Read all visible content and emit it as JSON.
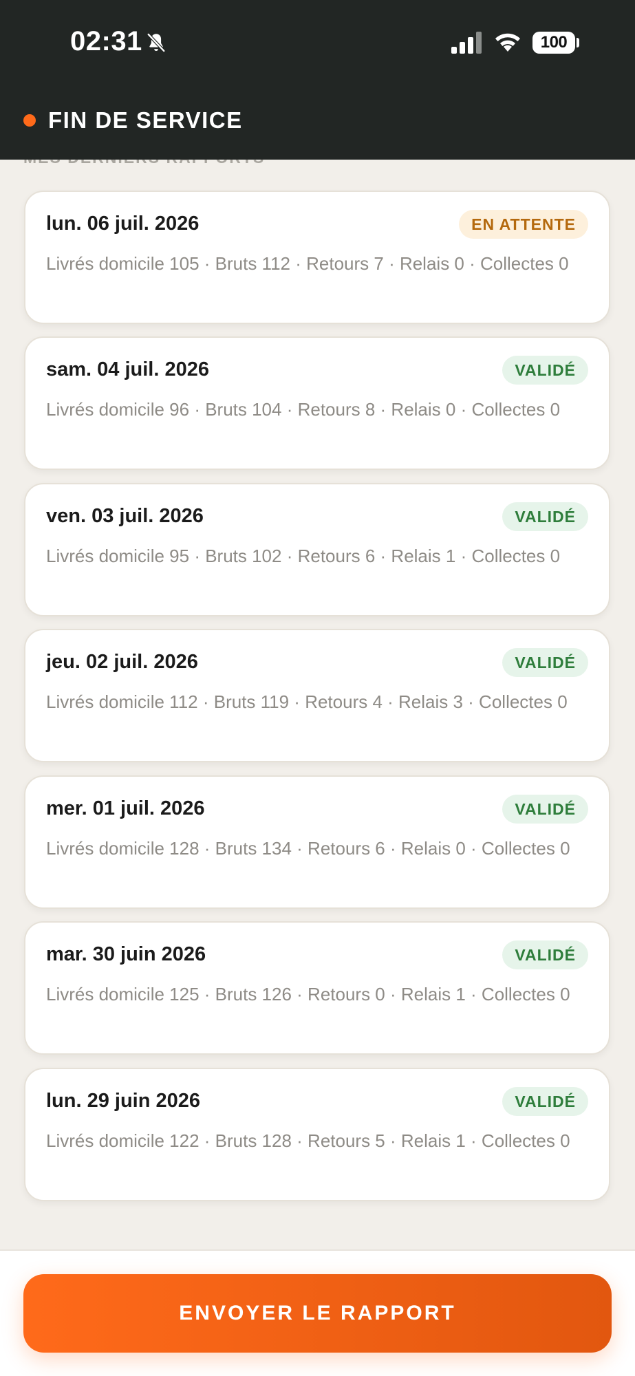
{
  "status_bar": {
    "time": "02:31",
    "battery": "100",
    "icons": [
      "bell-slash-icon",
      "signal-icon",
      "wifi-icon",
      "battery-icon"
    ]
  },
  "header": {
    "title": "FIN DE SERVICE",
    "accent_color": "#ff6a1a",
    "background_color": "#222624"
  },
  "section": {
    "title": "MES DERNIERS RAPPORTS"
  },
  "reports": [
    {
      "date": "lun. 06 juil. 2026",
      "status": "EN ATTENTE",
      "status_type": "pending",
      "stats": "Livrés domicile 105 · Bruts 112 · Retours 7 · Relais 0 · Collectes 0"
    },
    {
      "date": "sam. 04 juil. 2026",
      "status": "VALIDÉ",
      "status_type": "valid",
      "stats": "Livrés domicile 96 · Bruts 104 · Retours 8 · Relais 0 · Collectes 0"
    },
    {
      "date": "ven. 03 juil. 2026",
      "status": "VALIDÉ",
      "status_type": "valid",
      "stats": "Livrés domicile 95 · Bruts 102 · Retours 6 · Relais 1 · Collectes 0"
    },
    {
      "date": "jeu. 02 juil. 2026",
      "status": "VALIDÉ",
      "status_type": "valid",
      "stats": "Livrés domicile 112 · Bruts 119 · Retours 4 · Relais 3 · Collectes 0"
    },
    {
      "date": "mer. 01 juil. 2026",
      "status": "VALIDÉ",
      "status_type": "valid",
      "stats": "Livrés domicile 128 · Bruts 134 · Retours 6 · Relais 0 · Collectes 0"
    },
    {
      "date": "mar. 30 juin 2026",
      "status": "VALIDÉ",
      "status_type": "valid",
      "stats": "Livrés domicile 125 · Bruts 126 · Retours 0 · Relais 1 · Collectes 0"
    },
    {
      "date": "lun. 29 juin 2026",
      "status": "VALIDÉ",
      "status_type": "valid",
      "stats": "Livrés domicile 122 · Bruts 128 · Retours 5 · Relais 1 · Collectes 0"
    }
  ],
  "footer": {
    "send_label": "ENVOYER LE RAPPORT"
  },
  "colors": {
    "valid_bg": "#e6f4ea",
    "valid_text": "#2e7d3b",
    "pending_bg": "#fdf0dc",
    "pending_text": "#b4690e",
    "button": "#ff6a1a"
  }
}
